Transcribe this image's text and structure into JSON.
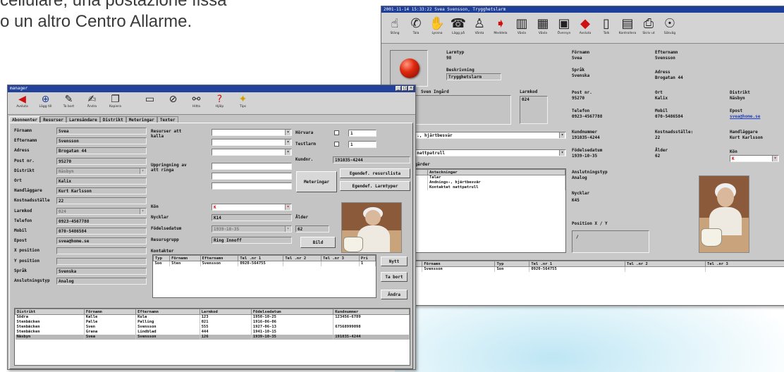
{
  "caption": {
    "line1": "cellulare, una postazione fissa",
    "line2": "o un altro Centro Allarme."
  },
  "back_window": {
    "title": "2001-11-14 15:33:22  Svea Svensson, Trygghetslarm",
    "toolbar": [
      {
        "icon": "finger-icon",
        "glyph": "☝",
        "label": "Stäng"
      },
      {
        "icon": "phone-finger-icon",
        "glyph": "✆",
        "label": "Tala"
      },
      {
        "icon": "hand-icon",
        "glyph": "✋",
        "label": "Lyssna"
      },
      {
        "icon": "phone-icon",
        "glyph": "☎",
        "label": "Lägg på"
      },
      {
        "icon": "person-icon",
        "glyph": "♙",
        "label": "Vänta"
      },
      {
        "icon": "arrow-icon",
        "glyph": "➧",
        "label": "Meddela"
      },
      {
        "icon": "building-icon",
        "glyph": "▥",
        "label": "Växla"
      },
      {
        "icon": "building2-icon",
        "glyph": "▦",
        "label": "Växla"
      },
      {
        "icon": "monitor-icon",
        "glyph": "▣",
        "label": "Översyn"
      },
      {
        "icon": "red-arrow-icon",
        "glyph": "◆",
        "label": "Avsluta"
      },
      {
        "icon": "panel-icon",
        "glyph": "▯",
        "label": "Talk"
      },
      {
        "icon": "bars-icon",
        "glyph": "▤",
        "label": "Kontrollera"
      },
      {
        "icon": "printer-icon",
        "glyph": "⎙",
        "label": "Skriv ut"
      },
      {
        "icon": "binoculars-icon",
        "glyph": "☉",
        "label": "Sökväg"
      }
    ],
    "labels": {
      "larmtyp": "Larmtyp",
      "beskrivning": "Beskrivning",
      "namn": "Namn",
      "larmkod": "Larmkod",
      "fornamn": "Förnamn",
      "sprak": "Språk",
      "postnr": "Post nr.",
      "telefon": "Telefon",
      "kundnummer": "Kundnummer",
      "fodelsedatum": "Födelsedatum",
      "anslutningstyp": "Anslutningstyp",
      "nycklar": "Nycklar",
      "position": "Position X / Y",
      "efternamn": "Efternamn",
      "adress": "Adress",
      "ort": "Ort",
      "mobil": "Mobil",
      "kostnadsstalle": "Kostnadsställe:",
      "alder": "Ålder",
      "distrikt": "Distrikt",
      "epost": "Epost",
      "handlaggare": "Handläggare",
      "kon": "Kön",
      "atgarder": "Åtgärder",
      "anteckningar": "Anteckningar"
    },
    "values": {
      "larmtyp": "98",
      "beskrivning": "Trygghetslarm",
      "namn": "Sven Ingård",
      "larmkod": "024",
      "fornamn": "Svea",
      "sprak": "Svenska",
      "postnr": "95270",
      "telefon": "0923-4567788",
      "kundnummer": "191035-4244",
      "fodelsedatum": "1939-10-35",
      "anslutningstyp": "Analog",
      "nycklar": "K45",
      "position": "/",
      "efternamn": "Svensson",
      "adress": "Brogatan 44",
      "ort": "Kalix",
      "mobil": "070-5486584",
      "kostnadsstalle": "22",
      "alder": "62",
      "distrikt": "Näsbyn",
      "epost": "svea@home.se",
      "handlaggare": "Kurt Karlsson",
      "kon": "K",
      "dropdown1": "..., hjärtbesvär",
      "dropdown2": "t nattpatrull",
      "notes": [
        "Talar",
        "Andnings-, hjärtbesvär",
        "Kontaktat nattpatrull"
      ]
    },
    "contacts": {
      "headers": [
        "",
        "Förnamn",
        "Typ",
        "Tel .nr 1",
        "Tel .nr 2",
        "Tel .nr 3"
      ],
      "rows": [
        [
          "",
          "Svensson",
          "Son",
          "0920-564755",
          "",
          ""
        ]
      ]
    }
  },
  "front_window": {
    "title": "manager",
    "toolbar": [
      {
        "icon": "back-arrow-icon",
        "glyph": "◀",
        "label": "Avsluta"
      },
      {
        "icon": "add-icon",
        "glyph": "⊕",
        "label": "Lägg till"
      },
      {
        "icon": "pen-icon",
        "glyph": "✎",
        "label": "Ta bort"
      },
      {
        "icon": "edit-icon",
        "glyph": "✍",
        "label": "Ändra"
      },
      {
        "icon": "copy-icon",
        "glyph": "❐",
        "label": "Kopiera"
      },
      {
        "icon": "save-icon",
        "glyph": "▭",
        "label": ""
      },
      {
        "icon": "cancel-icon",
        "glyph": "⊘",
        "label": ""
      },
      {
        "icon": "binoculars-icon",
        "glyph": "⚯",
        "label": "Hitta"
      },
      {
        "icon": "help-icon",
        "glyph": "?",
        "label": "Hjälp"
      },
      {
        "icon": "tip-icon",
        "glyph": "✦",
        "label": "Tips"
      }
    ],
    "tabs": [
      "Abonnenter",
      "Resurser",
      "Larmsändare",
      "Distrikt",
      "Meteringar",
      "Texter"
    ],
    "form": [
      {
        "label": "Förnamn",
        "value": "Svea"
      },
      {
        "label": "Efternamn",
        "value": "Svensson"
      },
      {
        "label": "Adress",
        "value": "Brogatan 44"
      },
      {
        "label": "Post nr.",
        "value": "95270"
      },
      {
        "label": "Distrikt",
        "value": "Näsbyn"
      },
      {
        "label": "Ort",
        "value": "Kalix"
      },
      {
        "label": "Handläggare",
        "value": "Kurt Karlsson"
      },
      {
        "label": "Kostnadsställe",
        "value": "22"
      },
      {
        "label": "Larmkod",
        "value": "024"
      },
      {
        "label": "Telefon",
        "value": "0923-4567788"
      },
      {
        "label": "Mobil",
        "value": "070-5486584"
      },
      {
        "label": "Epost",
        "value": "svea@home.se"
      },
      {
        "label": "X position",
        "value": ""
      },
      {
        "label": "Y position",
        "value": ""
      },
      {
        "label": "Språk",
        "value": "Svenska"
      },
      {
        "label": "Anslutningstyp",
        "value": "Analog"
      }
    ],
    "middle": {
      "resurser_label": "Resurser att kalla",
      "uppringning_label": "Uppringning av att ringa",
      "horvara_label": "Hörvara",
      "testlarm_label": "Testlarm",
      "horvara_value": "1",
      "testlarm_value": "1",
      "kundnr_label": "Kundnr.",
      "kundnr_value": "191035-4244",
      "meteringar_button": "Meteringar",
      "egen_resurs_button": "Egendef. resurslista",
      "egen_larm_button": "Egendef. Larmtyper",
      "kon_label": "Kön",
      "kon_value": "K",
      "nycklar_label": "Nycklar",
      "nycklar_value": "K14",
      "alder_label": "Ålder",
      "alder_value": "62",
      "fodelse_label": "Födelsedatum",
      "fodelse_value": "1939-10-35",
      "resurs_label": "Resursgrupp",
      "resurs_value": "Ring Innoff",
      "bild_button": "Bild",
      "kontakter_label": "Kontakter"
    },
    "contacts": {
      "headers": [
        "Typ",
        "Förnamn",
        "Efternamn",
        "Tel .nr 1",
        "Tel .nr 2",
        "Tel .nr 3",
        "Pri"
      ],
      "rows": [
        [
          "Son",
          "Sten",
          "Svensson",
          "0920-564755",
          "",
          "",
          "1"
        ]
      ]
    },
    "side_buttons": [
      "Nytt",
      "Ta bort",
      "Ändra"
    ],
    "grid": {
      "headers": [
        "Distrikt",
        "Förnamn",
        "Efternamn",
        "Larmkod",
        "Födelsedatum",
        "Kundnummer"
      ],
      "rows": [
        [
          "Södra",
          "Kalle",
          "Kula",
          "123",
          "1950-10-25",
          "123456-6789"
        ],
        [
          "Stenbäcken",
          "Palle",
          "Palling",
          "021",
          "1916-06-06",
          ""
        ],
        [
          "Stenbäcken",
          "Sven",
          "Svensson",
          "555",
          "1927-06-13",
          "67568999098"
        ],
        [
          "Stenbäcken",
          "Grana",
          "Lindblad",
          "444",
          "1941-10-15",
          ""
        ],
        [
          "Näsbyn",
          "Svea",
          "Svensson",
          "126",
          "1939-10-35",
          "191035-4244"
        ]
      ],
      "selected_row": 4
    }
  }
}
